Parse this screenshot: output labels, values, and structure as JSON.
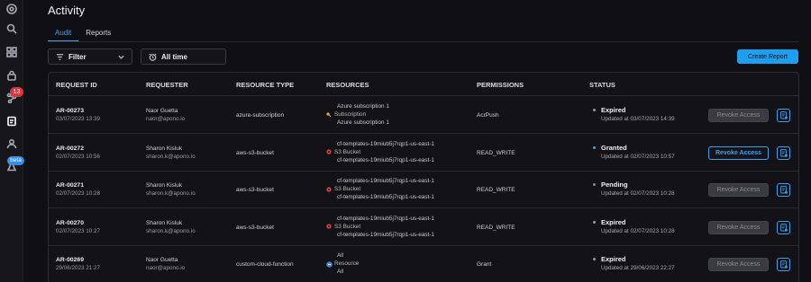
{
  "sidebar": {
    "icons": [
      "logo-icon",
      "search-icon",
      "grid-icon",
      "lock-icon",
      "nodes-icon",
      "audit-icon",
      "users-icon",
      "flask-icon"
    ],
    "badge_count": "13",
    "beta_label": "beta"
  },
  "header": {
    "title": "Activity",
    "tabs": [
      {
        "label": "Audit",
        "active": true
      },
      {
        "label": "Reports",
        "active": false
      }
    ]
  },
  "filters": {
    "filter_label": "Filter",
    "time_label": "All time",
    "create_report_label": "Create Report"
  },
  "table": {
    "columns": [
      "REQUEST ID",
      "REQUESTER",
      "RESOURCE TYPE",
      "RESOURCES",
      "PERMISSIONS",
      "STATUS"
    ],
    "rows": [
      {
        "id": "AR-00273",
        "date": "03/07/2023 13:39",
        "requester_name": "Naor Guetta",
        "requester_email": "naor@apono.io",
        "resource_type": "azure-subscription",
        "resource_name": "Azure subscription 1",
        "resource_kind": "Subscription",
        "resource_path": "Azure subscription 1",
        "resource_icon": "key-icon",
        "permission": "AcrPush",
        "status": "Expired",
        "status_color": "#9a9aa3",
        "updated": "Updated at 03/07/2023 14:39",
        "action": "Revoke Access",
        "action_enabled": false
      },
      {
        "id": "AR-00272",
        "date": "02/07/2023 10:56",
        "requester_name": "Sharon Kisluk",
        "requester_email": "sharon.k@apono.io",
        "resource_type": "aws-s3-bucket",
        "resource_name": "cf-templates-19miub5j7rqp1-us-east-1",
        "resource_kind": "S3 Bucket",
        "resource_path": "cf-templates-19miub5j7rqp1-us-east-1",
        "resource_icon": "s3-icon",
        "permission": "READ_WRITE",
        "status": "Granted",
        "status_color": "#3fa2e9",
        "updated": "Updated at 02/07/2023 10:57",
        "action": "Revoke Access",
        "action_enabled": true
      },
      {
        "id": "AR-00271",
        "date": "02/07/2023 10:28",
        "requester_name": "Sharon Kisluk",
        "requester_email": "sharon.k@apono.io",
        "resource_type": "aws-s3-bucket",
        "resource_name": "cf-templates-19miub5j7rqp1-us-east-1",
        "resource_kind": "S3 Bucket",
        "resource_path": "cf-templates-19miub5j7rqp1-us-east-1",
        "resource_icon": "s3-icon",
        "permission": "READ_WRITE",
        "status": "Pending",
        "status_color": "#8a8a92",
        "updated": "Updated at 02/07/2023 10:28",
        "action": "Revoke Access",
        "action_enabled": false
      },
      {
        "id": "AR-00270",
        "date": "02/07/2023 10:27",
        "requester_name": "Sharon Kisluk",
        "requester_email": "sharon.k@apono.io",
        "resource_type": "aws-s3-bucket",
        "resource_name": "cf-templates-19miub5j7rqp1-us-east-1",
        "resource_kind": "S3 Bucket",
        "resource_path": "cf-templates-19miub5j7rqp1-us-east-1",
        "resource_icon": "s3-icon",
        "permission": "READ_WRITE",
        "status": "Expired",
        "status_color": "#9a9aa3",
        "updated": "Updated at 02/07/2023 10:28",
        "action": "Revoke Access",
        "action_enabled": false
      },
      {
        "id": "AR-00269",
        "date": "29/06/2023 21:27",
        "requester_name": "Naor Guetta",
        "requester_email": "naor@apono.io",
        "resource_type": "custom-cloud-function",
        "resource_name": "All",
        "resource_kind": "Resource",
        "resource_path": "All",
        "resource_icon": "cloud-function-icon",
        "permission": "Grant",
        "status": "Expired",
        "status_color": "#9a9aa3",
        "updated": "Updated at 29/06/2023 22:27",
        "action": "Revoke Access",
        "action_enabled": false
      }
    ]
  },
  "colors": {
    "accent": "#3fa2e9",
    "background": "#101014",
    "badge_red": "#d9363e",
    "s3_red": "#e0453a",
    "key_yellow": "#e8b52c"
  }
}
